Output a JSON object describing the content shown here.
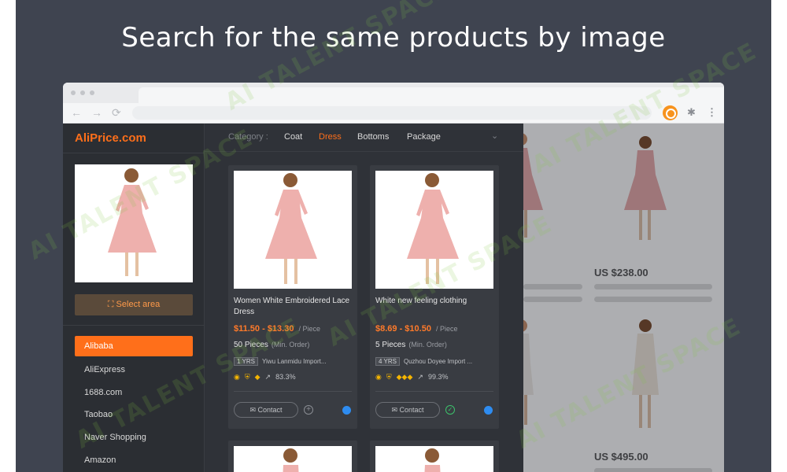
{
  "headline": "Search for the same products by image",
  "browser": {
    "nav": {
      "back": "←",
      "forward": "→",
      "reload": "⟳"
    },
    "toolbar_icons": {
      "extension": "aliprice-extension-icon",
      "puzzle": "puzzle-icon",
      "menu": "⋮"
    }
  },
  "background_site": {
    "prices": [
      "US $238.00",
      "US $495.00"
    ]
  },
  "panel": {
    "logo": "AliPrice.com",
    "select_area_label": "Select area",
    "sources": [
      "Alibaba",
      "AliExpress",
      "1688.com",
      "Taobao",
      "Naver Shopping",
      "Amazon"
    ],
    "active_source": "Alibaba",
    "category_label": "Category :",
    "categories": [
      "Coat",
      "Dress",
      "Bottoms",
      "Package"
    ],
    "active_category": "Dress",
    "results": [
      {
        "title": "Women White Embroidered Lace Dress",
        "price": "$11.50 - $13.30",
        "unit": "/ Piece",
        "moq": "50 Pieces",
        "moq_note": "(Min. Order)",
        "years": "1 YRS",
        "supplier": "Yiwu Lanmidu Import...",
        "response_rate": "83.3%",
        "contact_label": "Contact"
      },
      {
        "title": "White new feeling clothing",
        "price": "$8.69 - $10.50",
        "unit": "/ Piece",
        "moq": "5 Pieces",
        "moq_note": "(Min. Order)",
        "years": "4 YRS",
        "supplier": "Quzhou Doyee Import ...",
        "response_rate": "99.3%",
        "contact_label": "Contact"
      }
    ]
  },
  "watermark": "AI TALENT SPACE",
  "colors": {
    "accent": "#ff6f1a",
    "panel_bg": "#2f3238",
    "stage_bg": "#3f4450",
    "chat_blue": "#2e8cf0",
    "check_green": "#3cc26b"
  }
}
